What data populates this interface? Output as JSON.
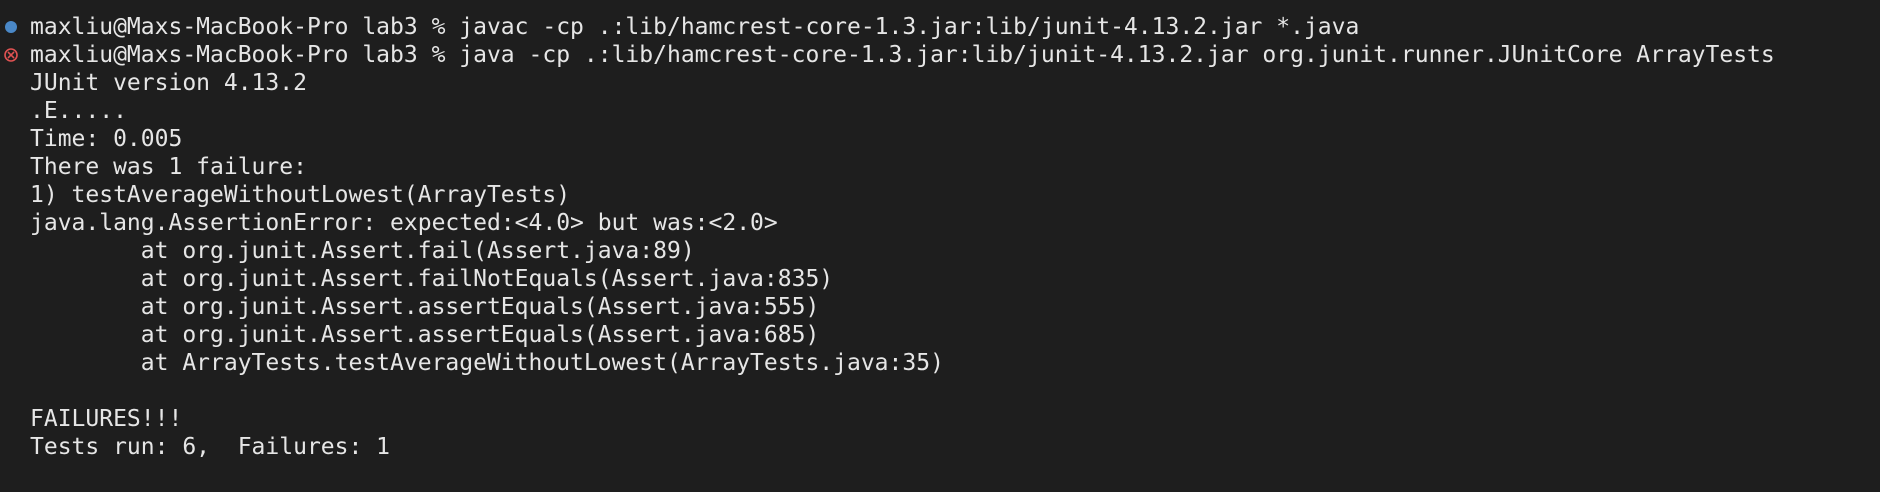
{
  "terminal": {
    "cmd1": {
      "status": "success",
      "prompt": "maxliu@Maxs-MacBook-Pro lab3 % ",
      "command": "javac -cp .:lib/hamcrest-core-1.3.jar:lib/junit-4.13.2.jar *.java"
    },
    "cmd2": {
      "status": "error",
      "prompt": "maxliu@Maxs-MacBook-Pro lab3 % ",
      "command": "java -cp .:lib/hamcrest-core-1.3.jar:lib/junit-4.13.2.jar org.junit.runner.JUnitCore ArrayTests"
    },
    "output": [
      "JUnit version 4.13.2",
      ".E.....",
      "Time: 0.005",
      "There was 1 failure:",
      "1) testAverageWithoutLowest(ArrayTests)",
      "java.lang.AssertionError: expected:<4.0> but was:<2.0>",
      "        at org.junit.Assert.fail(Assert.java:89)",
      "        at org.junit.Assert.failNotEquals(Assert.java:835)",
      "        at org.junit.Assert.assertEquals(Assert.java:555)",
      "        at org.junit.Assert.assertEquals(Assert.java:685)",
      "        at ArrayTests.testAverageWithoutLowest(ArrayTests.java:35)",
      "",
      "FAILURES!!!",
      "Tests run: 6,  Failures: 1"
    ]
  },
  "colors": {
    "background": "#1e1e1e",
    "text": "#e6e6e6",
    "success_dot": "#4a88c7",
    "error_icon": "#e05252"
  }
}
